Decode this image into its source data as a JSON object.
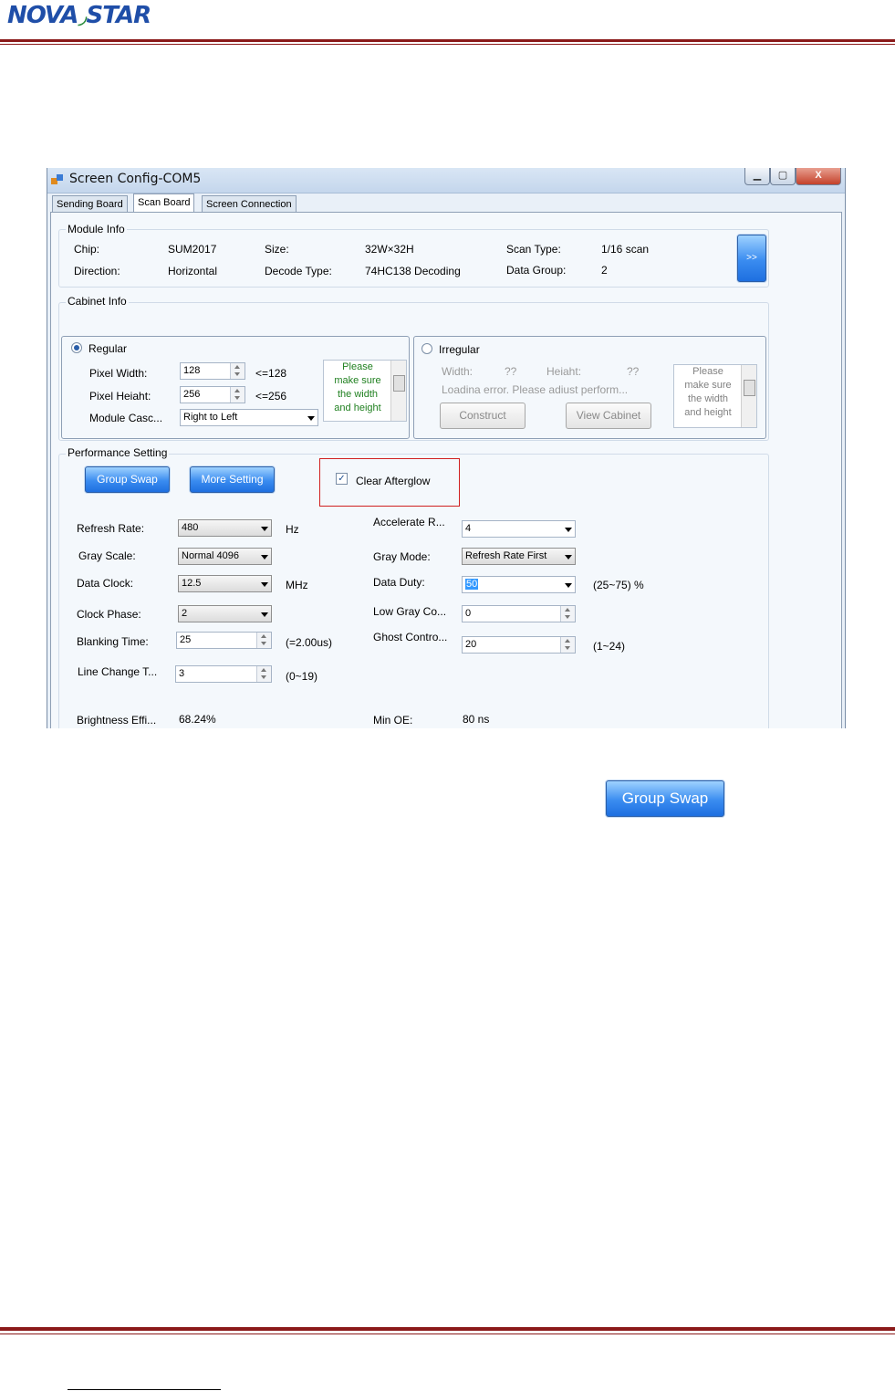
{
  "page": {
    "logo_left": "NOVA",
    "logo_right": "STAR"
  },
  "window": {
    "title": "Screen Config-COM5",
    "controls": {
      "minimize": "▁",
      "restore": "▢",
      "close": "X"
    },
    "tabs": [
      "Sending Board",
      "Scan Board",
      "Screen Connection"
    ],
    "active_tab": "Scan Board"
  },
  "module_info": {
    "label": "Module Info",
    "chip_label": "Chip:",
    "chip_value": "SUM2017",
    "size_label": "Size:",
    "size_value": "32W×32H",
    "scan_type_label": "Scan Type:",
    "scan_type_value": "1/16 scan",
    "direction_label": "Direction:",
    "direction_value": "Horizontal",
    "decode_type_label": "Decode Type:",
    "decode_type_value": "74HC138 Decoding",
    "data_group_label": "Data Group:",
    "data_group_value": "2",
    "more_button": ">>"
  },
  "cabinet_info": {
    "label": "Cabinet Info",
    "regular": {
      "label": "Regular",
      "pixel_width_label": "Pixel Width:",
      "pixel_width_value": "128",
      "pixel_width_limit": "<=128",
      "pixel_height_label": "Pixel Heiaht:",
      "pixel_height_value": "256",
      "pixel_height_limit": "<=256",
      "module_cascade_label": "Module Casc...",
      "module_cascade_value": "Right to Left",
      "note_lines": [
        "Please",
        "make sure",
        "the width",
        "and height"
      ]
    },
    "irregular": {
      "label": "Irregular",
      "width_label": "Width:",
      "width_value": "??",
      "height_label": "Heiaht:",
      "height_value": "??",
      "error_text": "Loadina error. Please adiust perform...",
      "construct_button": "Construct",
      "view_cabinet_button": "View Cabinet",
      "note_lines": [
        "Please",
        "make sure",
        "the width",
        "and height"
      ]
    }
  },
  "performance": {
    "label": "Performance Setting",
    "group_swap_button": "Group Swap",
    "more_setting_button": "More Setting",
    "clear_afterglow_label": "Clear Afterglow",
    "refresh_rate_label": "Refresh Rate:",
    "refresh_rate_value": "480",
    "refresh_rate_unit": "Hz",
    "gray_scale_label": "Gray Scale:",
    "gray_scale_value": "Normal 4096",
    "data_clock_label": "Data Clock:",
    "data_clock_value": "12.5",
    "data_clock_unit": "MHz",
    "clock_phase_label": "Clock Phase:",
    "clock_phase_value": "2",
    "blanking_time_label": "Blanking Time:",
    "blanking_time_value": "25",
    "blanking_time_note": "(=2.00us)",
    "line_change_label": "Line Change T...",
    "line_change_value": "3",
    "line_change_range": "(0~19)",
    "accelerate_label": "Accelerate R...",
    "accelerate_value": "4",
    "gray_mode_label": "Gray Mode:",
    "gray_mode_value": "Refresh Rate First",
    "data_duty_label": "Data Duty:",
    "data_duty_value": "50",
    "data_duty_range": "(25~75) %",
    "low_gray_label": "Low Gray Co...",
    "low_gray_value": "0",
    "ghost_label": "Ghost Contro...",
    "ghost_value": "20",
    "ghost_range": "(1~24)",
    "brightness_label": "Brightness Effi...",
    "brightness_value": "68.24%",
    "min_oe_label": "Min OE:",
    "min_oe_value": "80 ns"
  },
  "standalone_button": "Group Swap"
}
